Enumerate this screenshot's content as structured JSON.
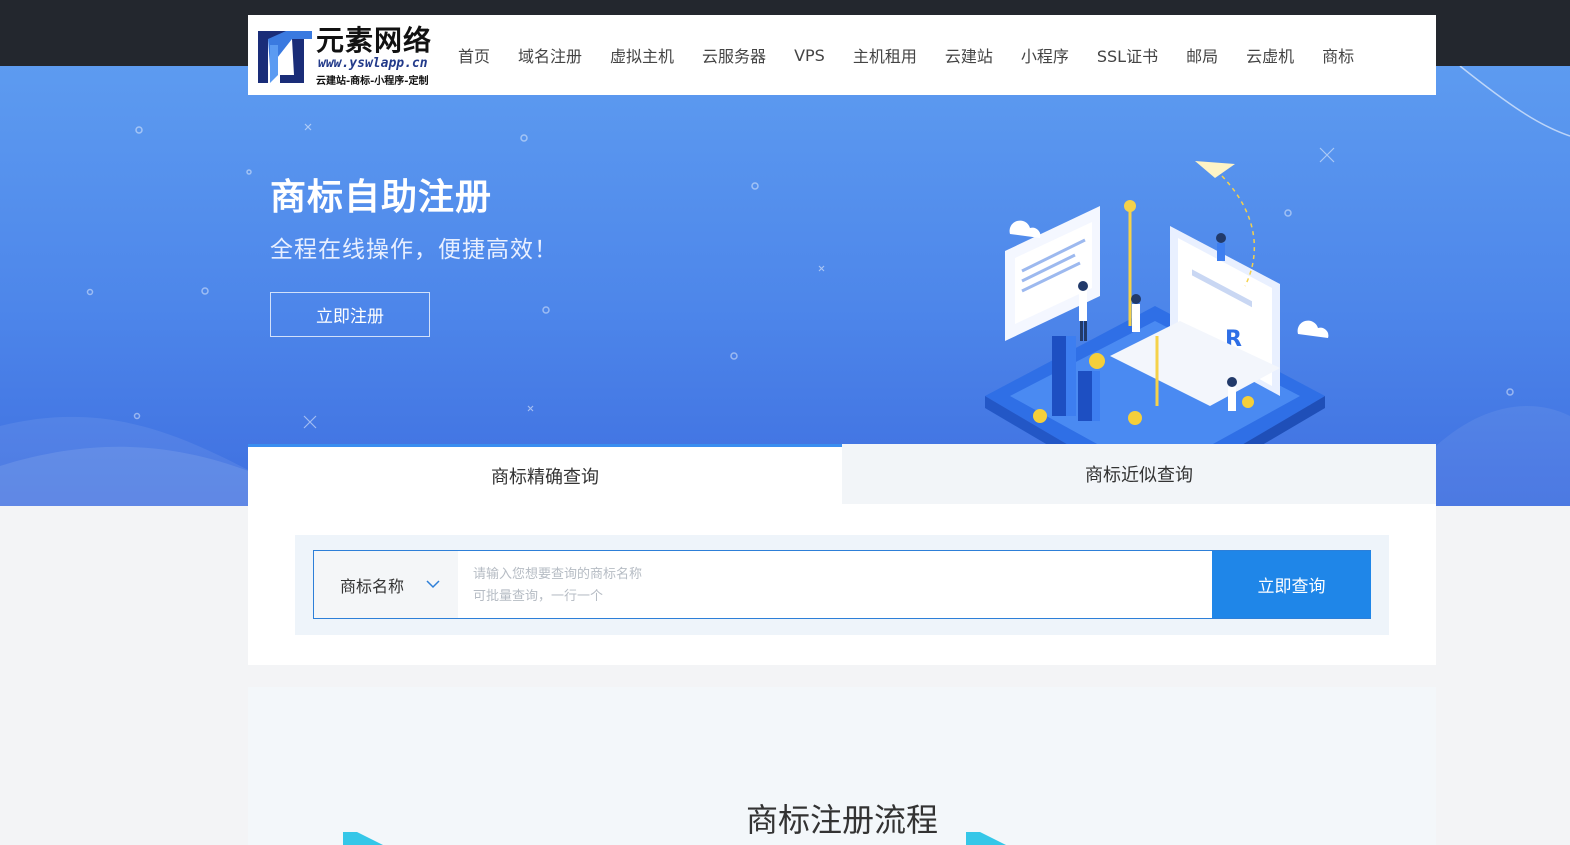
{
  "logo": {
    "title": "元素网络",
    "url": "www.yswlapp.cn",
    "tagline": "云建站-商标-小程序-定制"
  },
  "nav": {
    "items": [
      "首页",
      "域名注册",
      "虚拟主机",
      "云服务器",
      "VPS",
      "主机租用",
      "云建站",
      "小程序",
      "SSL证书",
      "邮局",
      "云虚机",
      "商标"
    ]
  },
  "hero": {
    "title": "商标自助注册",
    "subtitle": "全程在线操作，便捷高效！",
    "button_label": "立即注册"
  },
  "search": {
    "tabs": [
      "商标精确查询",
      "商标近似查询"
    ],
    "active_tab": 0,
    "type_label": "商标名称",
    "placeholder": "请输入您想要查询的商标名称\n可批量查询，一行一个",
    "button_label": "立即查询"
  },
  "process": {
    "title": "商标注册流程"
  },
  "colors": {
    "accent": "#1f86e8",
    "topbar": "#23272e",
    "hero_top": "#5d9bf0",
    "hero_bottom": "#3f6fe0"
  },
  "icons": {
    "logo": "logo-mark-icon",
    "dropdown": "chevron-down-icon",
    "illustration": "trademark-laptop-illustration"
  }
}
